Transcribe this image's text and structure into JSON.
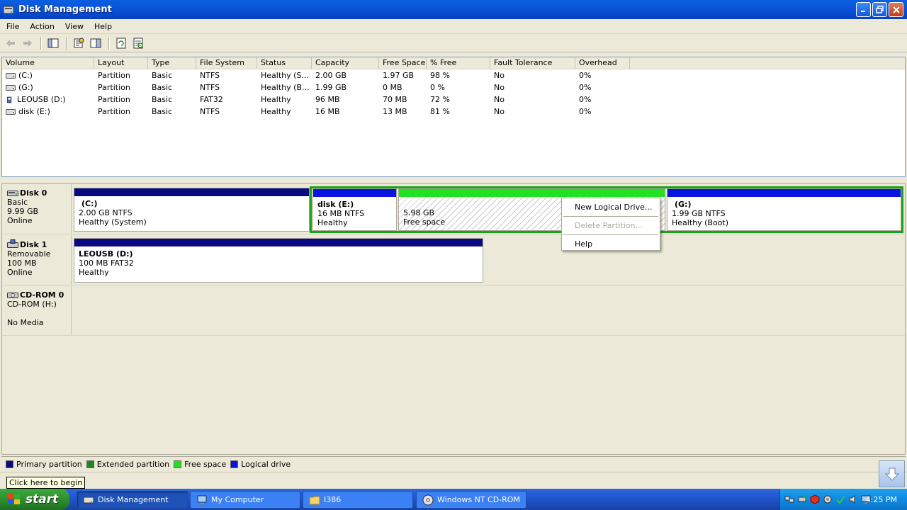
{
  "window": {
    "title": "Disk Management"
  },
  "menu": [
    "File",
    "Action",
    "View",
    "Help"
  ],
  "volume_list": {
    "columns": [
      "Volume",
      "Layout",
      "Type",
      "File System",
      "Status",
      "Capacity",
      "Free Space",
      "% Free",
      "Fault Tolerance",
      "Overhead"
    ],
    "rows": [
      [
        "(C:)",
        "Partition",
        "Basic",
        "NTFS",
        "Healthy (S...",
        "2.00 GB",
        "1.97 GB",
        "98 %",
        "No",
        "0%"
      ],
      [
        "(G:)",
        "Partition",
        "Basic",
        "NTFS",
        "Healthy (B...",
        "1.99 GB",
        "0 MB",
        "0 %",
        "No",
        "0%"
      ],
      [
        "LEOUSB (D:)",
        "Partition",
        "Basic",
        "FAT32",
        "Healthy",
        "96 MB",
        "70 MB",
        "72 %",
        "No",
        "0%"
      ],
      [
        "disk  (E:)",
        "Partition",
        "Basic",
        "NTFS",
        "Healthy",
        "16 MB",
        "13 MB",
        "81 %",
        "No",
        "0%"
      ]
    ]
  },
  "disks": {
    "disk0": {
      "name": "Disk 0",
      "type": "Basic",
      "size": "9.99 GB",
      "status": "Online",
      "c": {
        "name": "(C:)",
        "size": "2.00 GB NTFS",
        "status": "Healthy (System)"
      },
      "e": {
        "name": "disk  (E:)",
        "size": "16 MB NTFS",
        "status": "Healthy"
      },
      "free": {
        "size": "5.98 GB",
        "status": "Free space"
      },
      "g": {
        "name": "(G:)",
        "size": "1.99 GB NTFS",
        "status": "Healthy (Boot)"
      }
    },
    "disk1": {
      "name": "Disk 1",
      "type": "Removable",
      "size": "100 MB",
      "status": "Online",
      "d": {
        "name": "LEOUSB  (D:)",
        "size": "100 MB FAT32",
        "status": "Healthy"
      }
    },
    "cdrom0": {
      "name": "CD-ROM 0",
      "drive": "CD-ROM (H:)",
      "status": "No Media"
    }
  },
  "context_menu": {
    "new_logical": "New Logical Drive...",
    "delete": "Delete Partition...",
    "help": "Help"
  },
  "legend": [
    {
      "label": "Primary partition",
      "color": "#0a0a80"
    },
    {
      "label": "Extended partition",
      "color": "#1a8a1a"
    },
    {
      "label": "Free space",
      "color": "#22e022"
    },
    {
      "label": "Logical drive",
      "color": "#0a14e0"
    }
  ],
  "colors": {
    "primary": "#0a0a80",
    "extended": "#1aa21a",
    "free": "#22e022",
    "logical": "#0a14e0"
  },
  "tooltip": "Click here to begin",
  "taskbar": {
    "start": "start",
    "tasks": [
      "Disk Management",
      "My Computer",
      "I386",
      "Windows NT CD-ROM"
    ],
    "clock": "4:25 PM"
  }
}
